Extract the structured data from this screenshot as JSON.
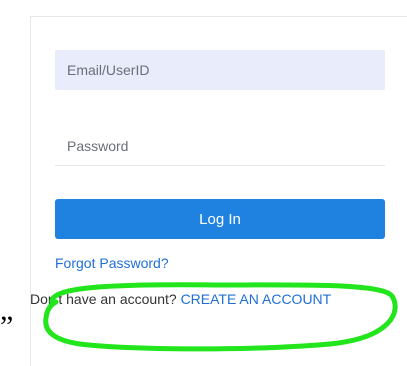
{
  "login_form": {
    "email_placeholder": "Email/UserID",
    "password_placeholder": "Password",
    "login_button_label": "Log In",
    "forgot_password_label": "Forgot Password?",
    "signup_prompt": "Don't have an account?",
    "create_account_label": "CREATE AN ACCOUNT"
  },
  "annotation": {
    "highlight_color": "#22e51c",
    "stray_mark": "”"
  },
  "colors": {
    "primary_button": "#1f82e0",
    "link": "#1f6fd6",
    "input_fill": "#e8ecfb",
    "panel_background": "#eef0f4"
  }
}
